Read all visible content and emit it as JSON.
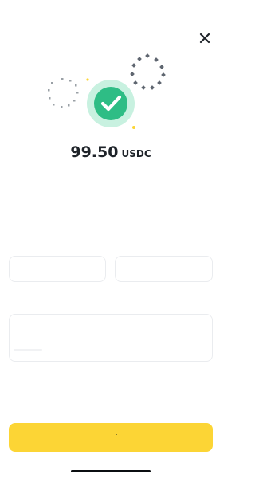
{
  "header": {
    "close_icon": "close-icon"
  },
  "result": {
    "status_icon": "check-icon",
    "amount_value": "99.50",
    "amount_unit": "USDC"
  },
  "colors": {
    "success": "#2ebd85",
    "success_ring": "#c8f1e0",
    "accent_yellow": "#fcd535",
    "text_primary": "#1e2329",
    "border": "#eaecef"
  },
  "actions": {
    "primary_label": ""
  }
}
